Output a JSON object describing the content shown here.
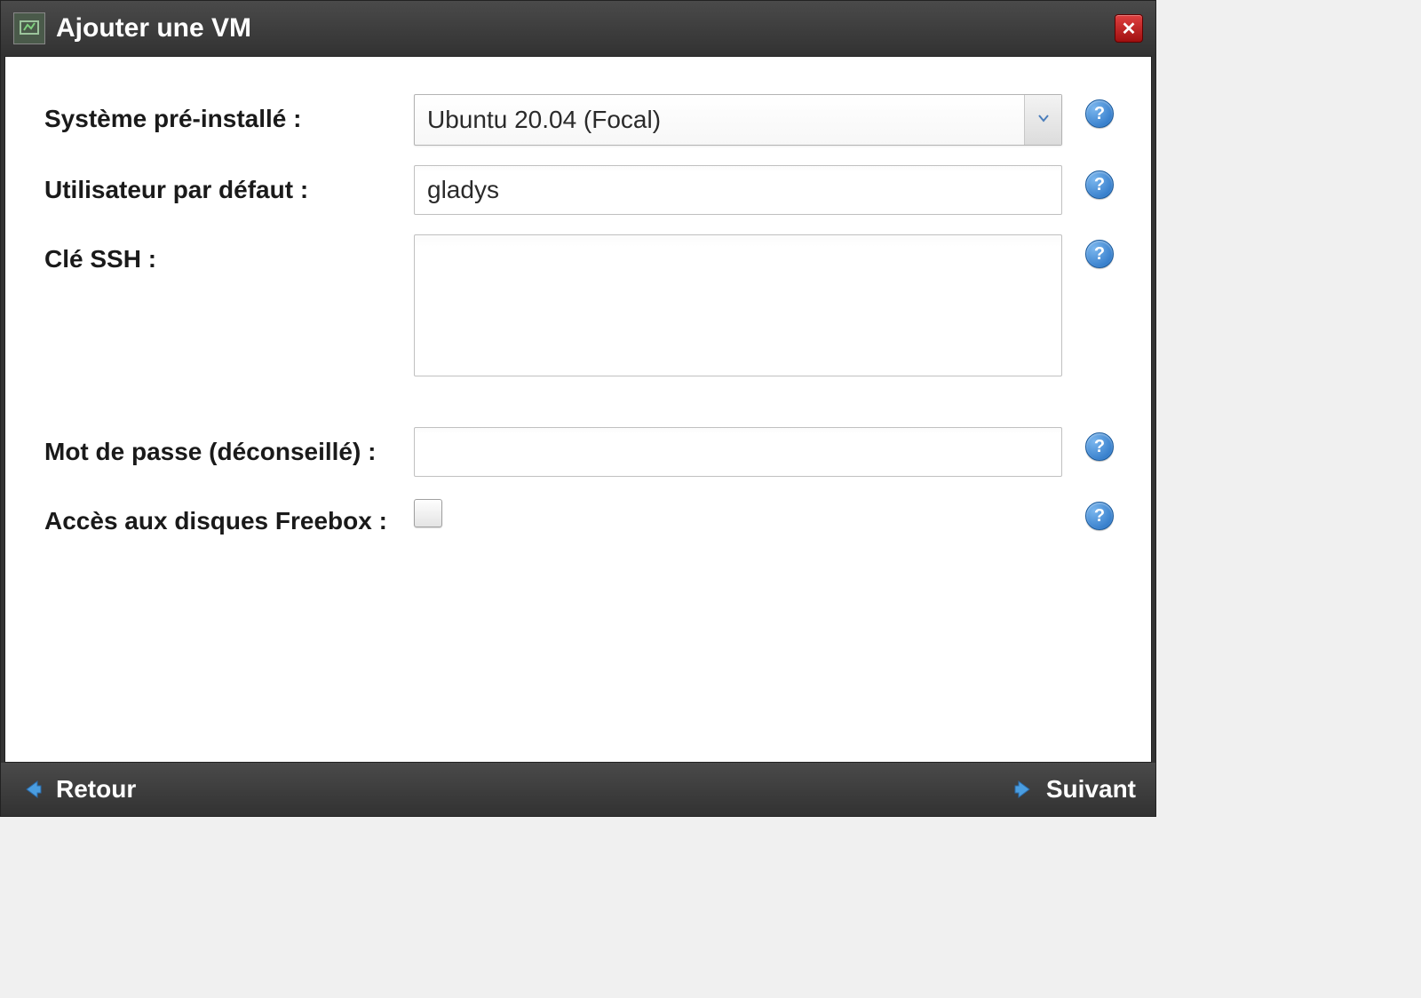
{
  "window": {
    "title": "Ajouter une VM"
  },
  "form": {
    "system": {
      "label": "Système pré-installé :",
      "value": "Ubuntu 20.04 (Focal)"
    },
    "default_user": {
      "label": "Utilisateur par défaut :",
      "value": "gladys"
    },
    "ssh_key": {
      "label": "Clé SSH :",
      "value": ""
    },
    "password": {
      "label": "Mot de passe (déconseillé) :",
      "value": ""
    },
    "disk_access": {
      "label": "Accès aux disques Freebox :",
      "checked": false
    }
  },
  "footer": {
    "back_label": "Retour",
    "next_label": "Suivant"
  },
  "icons": {
    "help_glyph": "?",
    "close_glyph": "✕"
  }
}
